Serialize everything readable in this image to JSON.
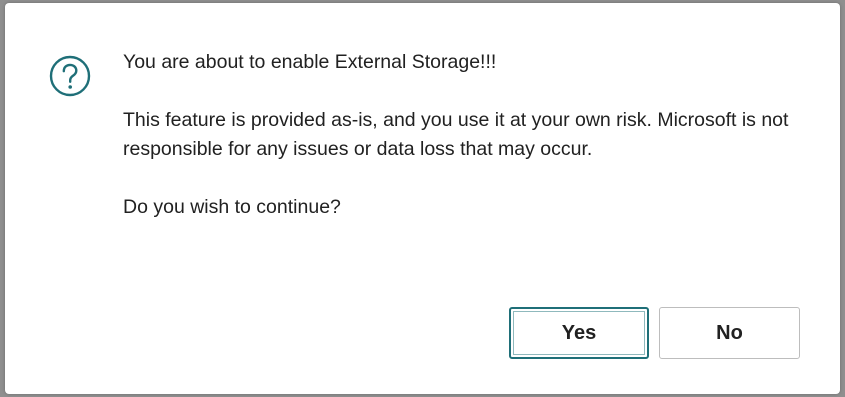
{
  "dialog": {
    "icon": "question-circle-icon",
    "accent_color": "#1f6f78",
    "title": "You are about to enable External Storage!!!",
    "body": "This feature is provided as-is, and you use it at your own risk. Microsoft is not responsible for any issues or data loss that may occur.",
    "prompt": "Do you wish to continue?",
    "buttons": {
      "yes_label": "Yes",
      "no_label": "No"
    }
  }
}
